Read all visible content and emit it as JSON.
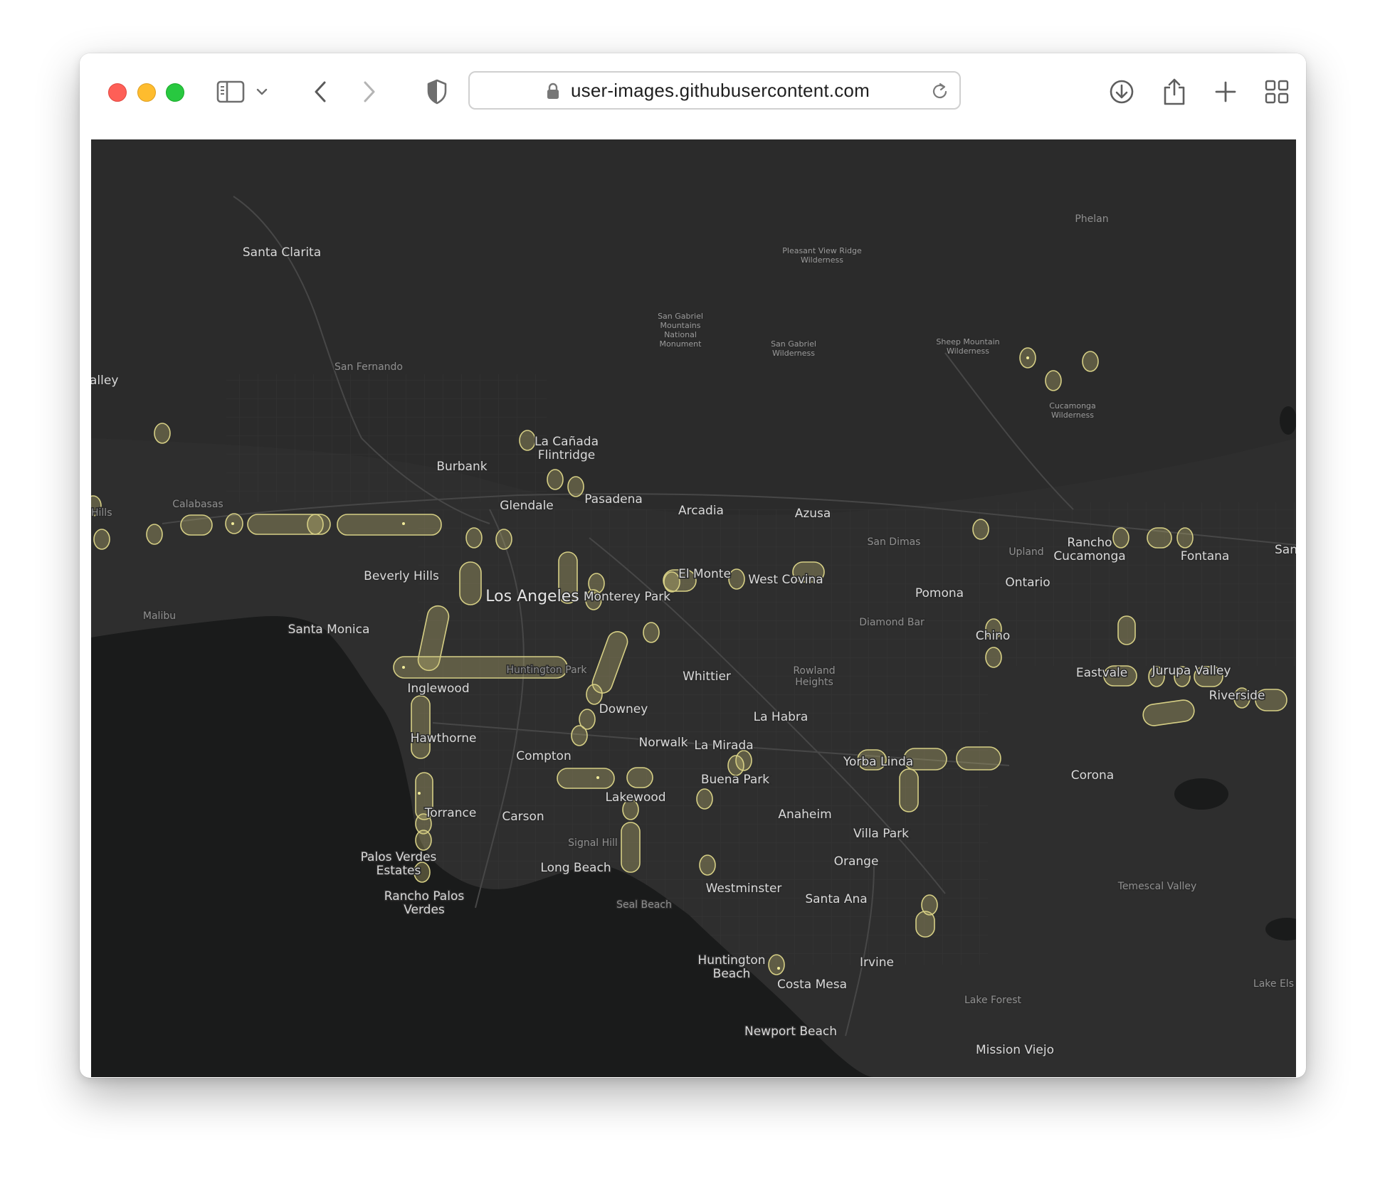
{
  "browser": {
    "url": "user-images.githubusercontent.com",
    "icons": {
      "sidebar": "sidebar-icon",
      "sidebar_menu": "chevron-down-icon",
      "back": "chevron-left-icon",
      "forward": "chevron-right-icon",
      "privacy": "shield-icon",
      "lock": "lock-icon",
      "reload": "reload-icon",
      "download": "download-icon",
      "share": "share-icon",
      "new_tab": "plus-icon",
      "tab_overview": "grid-icon"
    }
  },
  "map": {
    "colors": {
      "land": "#2e2e2e",
      "water": "#1a1b1b",
      "roads": "#3d3d3d",
      "highlight": "#cfc77a"
    },
    "labels": [
      {
        "text": "Santa Clarita",
        "size": "md"
      },
      {
        "text": "Phelan",
        "size": "sm"
      },
      {
        "text": "Pleasant View Ridge Wilderness",
        "size": "xs"
      },
      {
        "text": "San Gabriel Mountains National Monument",
        "size": "xs"
      },
      {
        "text": "San Gabriel Wilderness",
        "size": "xs"
      },
      {
        "text": "Sheep Mountain Wilderness",
        "size": "xs"
      },
      {
        "text": "Cucamonga Wilderness",
        "size": "xs"
      },
      {
        "text": "alley",
        "size": "md"
      },
      {
        "text": "San Fernando",
        "size": "sm"
      },
      {
        "text": "La Cañada Flintridge",
        "size": "md"
      },
      {
        "text": "Burbank",
        "size": "md"
      },
      {
        "text": "Calabasas",
        "size": "sm"
      },
      {
        "text": "Hills",
        "size": "sm"
      },
      {
        "text": "Glendale",
        "size": "md"
      },
      {
        "text": "Pasadena",
        "size": "md"
      },
      {
        "text": "Arcadia",
        "size": "md"
      },
      {
        "text": "Azusa",
        "size": "md"
      },
      {
        "text": "San Dimas",
        "size": "sm"
      },
      {
        "text": "Upland",
        "size": "sm"
      },
      {
        "text": "Rancho Cucamonga",
        "size": "md"
      },
      {
        "text": "Fontana",
        "size": "md"
      },
      {
        "text": "San",
        "size": "md"
      },
      {
        "text": "Beverly Hills",
        "size": "md"
      },
      {
        "text": "Los Angeles",
        "size": "lg"
      },
      {
        "text": "El Monte",
        "size": "md"
      },
      {
        "text": "West Covina",
        "size": "md"
      },
      {
        "text": "Pomona",
        "size": "md"
      },
      {
        "text": "Ontario",
        "size": "md"
      },
      {
        "text": "Malibu",
        "size": "sm"
      },
      {
        "text": "Monterey Park",
        "size": "md"
      },
      {
        "text": "Santa Monica",
        "size": "md"
      },
      {
        "text": "Diamond Bar",
        "size": "sm"
      },
      {
        "text": "Chino",
        "size": "md"
      },
      {
        "text": "Huntington Park",
        "size": "sm"
      },
      {
        "text": "Rowland Heights",
        "size": "sm"
      },
      {
        "text": "Eastvale",
        "size": "md"
      },
      {
        "text": "Jurupa Valley",
        "size": "md"
      },
      {
        "text": "Inglewood",
        "size": "md"
      },
      {
        "text": "Whittier",
        "size": "md"
      },
      {
        "text": "Riverside",
        "size": "md"
      },
      {
        "text": "Downey",
        "size": "md"
      },
      {
        "text": "La Habra",
        "size": "md"
      },
      {
        "text": "Hawthorne",
        "size": "md"
      },
      {
        "text": "Norwalk",
        "size": "md"
      },
      {
        "text": "La Mirada",
        "size": "md"
      },
      {
        "text": "Compton",
        "size": "md"
      },
      {
        "text": "Yorba Linda",
        "size": "md"
      },
      {
        "text": "Corona",
        "size": "md"
      },
      {
        "text": "Buena Park",
        "size": "md"
      },
      {
        "text": "Lakewood",
        "size": "md"
      },
      {
        "text": "Torrance",
        "size": "md"
      },
      {
        "text": "Carson",
        "size": "md"
      },
      {
        "text": "Anaheim",
        "size": "md"
      },
      {
        "text": "Villa Park",
        "size": "md"
      },
      {
        "text": "Signal Hill",
        "size": "sm"
      },
      {
        "text": "Palos Verdes Estates",
        "size": "md"
      },
      {
        "text": "Orange",
        "size": "md"
      },
      {
        "text": "Long Beach",
        "size": "md"
      },
      {
        "text": "Temescal Valley",
        "size": "sm"
      },
      {
        "text": "Westminster",
        "size": "md"
      },
      {
        "text": "Rancho Palos Verdes",
        "size": "md"
      },
      {
        "text": "Santa Ana",
        "size": "md"
      },
      {
        "text": "Seal Beach",
        "size": "sm"
      },
      {
        "text": "Huntington Beach",
        "size": "md"
      },
      {
        "text": "Irvine",
        "size": "md"
      },
      {
        "text": "Lake Els",
        "size": "sm"
      },
      {
        "text": "Costa Mesa",
        "size": "md"
      },
      {
        "text": "Lake Forest",
        "size": "sm"
      },
      {
        "text": "Newport Beach",
        "size": "md"
      },
      {
        "text": "Mission Viejo",
        "size": "md"
      }
    ]
  }
}
